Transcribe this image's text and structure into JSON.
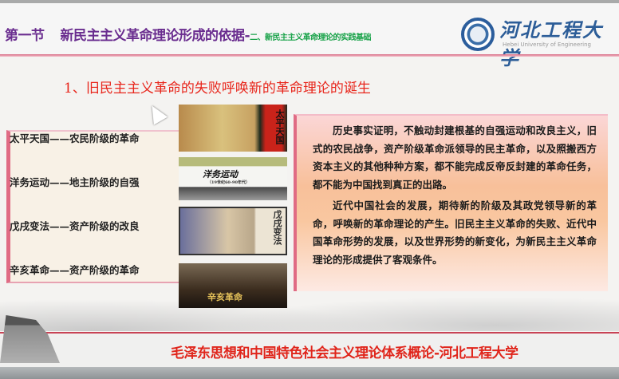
{
  "header": {
    "section": "第一节",
    "title": "新民主主义革命理论形成的依据",
    "separator": "-",
    "subtitle": "二、新民主主义革命理论的实践基础",
    "logo_cn": "河北工程大学",
    "logo_en": "Hebei University of Engineering"
  },
  "heading": "1、旧民主主义革命的失败呼唤新的革命理论的诞生",
  "movements": [
    {
      "name": "太平天国",
      "dash": "——",
      "nature": "农民阶级的革命",
      "picture_text": "太平天国"
    },
    {
      "name": "洋务运动",
      "dash": "——",
      "nature": "地主阶级的自强",
      "picture_text": "洋务运动",
      "picture_sub": "（19世纪60-90年代）"
    },
    {
      "name": "戊戌变法",
      "dash": "——",
      "nature": "资产阶级的改良",
      "picture_text": "戊戌变法"
    },
    {
      "name": "辛亥革命",
      "dash": "——",
      "nature": "资产阶级的革命",
      "picture_text": "辛亥革命"
    }
  ],
  "paragraphs": [
    "历史事实证明，不触动封建根基的自强运动和改良主义，旧式的农民战争，资产阶级革命派领导的民主革命，以及照搬西方资本主义的其他种种方案，都不能完成反帝反封建的革命任务，都不能为中国找到真正的出路。",
    "近代中国社会的发展，期待新的阶级及其政党领导新的革命，呼唤新的革命理论的产生。旧民主主义革命的失败、近代中国革命形势的发展，以及世界形势的新变化，为新民主主义革命理论的形成提供了客观条件。"
  ],
  "footer": "毛泽东思想和中国特色社会主义理论体系概论-河北工程大学"
}
